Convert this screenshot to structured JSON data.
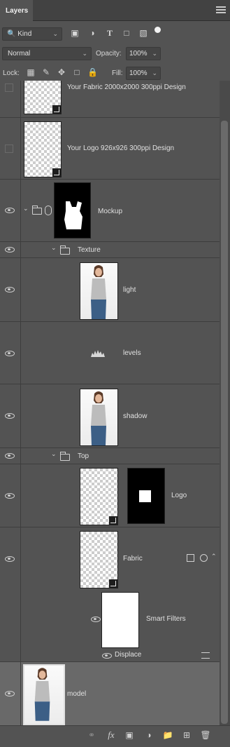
{
  "panel": {
    "title": "Layers"
  },
  "filter": {
    "kind_label": "Kind"
  },
  "blend": {
    "mode": "Normal",
    "opacity_label": "Opacity:",
    "opacity_value": "100%"
  },
  "lock": {
    "label": "Lock:",
    "fill_label": "Fill:",
    "fill_value": "100%"
  },
  "layers": [
    {
      "name": "Your Fabric 2000x2000 300ppi Design",
      "visible": false
    },
    {
      "name": "Your Logo 926x926 300ppi Design",
      "visible": false
    },
    {
      "name": "Mockup",
      "visible": true
    },
    {
      "name": "Texture",
      "visible": true
    },
    {
      "name": "light",
      "visible": true
    },
    {
      "name": "levels",
      "visible": true
    },
    {
      "name": "shadow",
      "visible": true
    },
    {
      "name": "Top",
      "visible": true
    },
    {
      "name": "Logo",
      "visible": true
    },
    {
      "name": "Fabric",
      "visible": true
    },
    {
      "name": "Smart Filters",
      "visible": true
    },
    {
      "name": "Displace",
      "visible": true
    },
    {
      "name": "model",
      "visible": true,
      "selected": true
    }
  ],
  "icons": {
    "search": "search-icon",
    "image_filter": "image-filter-icon",
    "adjustment_filter": "adjustment-filter-icon",
    "type_filter": "type-filter-icon",
    "shape_filter": "shape-filter-icon",
    "smart_filter": "smart-object-filter-icon",
    "link": "link-layers-icon",
    "fx": "fx-icon",
    "mask": "add-mask-icon",
    "adjust": "new-adjustment-icon",
    "group": "new-group-icon",
    "new_layer": "new-layer-icon",
    "trash": "trash-icon"
  },
  "colors": {
    "panel_bg": "#535353",
    "selected_row": "#696969",
    "header_bg": "#424242"
  }
}
